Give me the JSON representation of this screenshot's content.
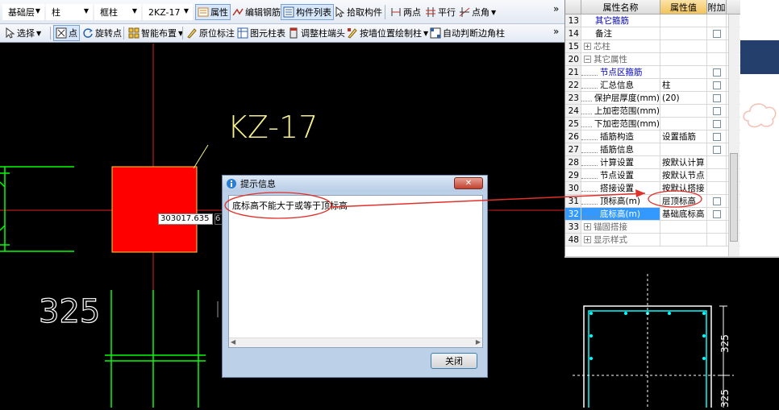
{
  "toolbar_top": {
    "floor_select": "基础层",
    "type_select": "柱",
    "subtype_select": "框柱",
    "member_select": "2KZ-17",
    "buttons": {
      "property": "属性",
      "edit_rebar": "编辑钢筋",
      "member_list": "构件列表",
      "pick_member": "拾取构件",
      "two_points": "两点",
      "parallel": "平行",
      "point_angle": "点角"
    },
    "more": "»"
  },
  "toolbar_bottom": {
    "buttons": {
      "select": "选择",
      "point": "点",
      "rotate_point": "旋转点",
      "smart_layout": "智能布置",
      "origin_annotate": "原位标注",
      "element_table": "图元柱表",
      "adjust_column_end": "调整柱端头",
      "draw_by_wall": "按墙位置绘制柱",
      "auto_corner": "自动判断边角柱"
    },
    "more": "»"
  },
  "canvas": {
    "column_label": "KZ-17",
    "dimension_label": "325",
    "coordinate_value": "303017.635",
    "coordinate_value2": "6"
  },
  "property_panel": {
    "headers": {
      "name": "属性名称",
      "value": "属性值",
      "add": "附加"
    },
    "rows": [
      {
        "num": "13",
        "name": "其它箍筋",
        "value": "",
        "has_check": false,
        "kind": "link",
        "expander": ""
      },
      {
        "num": "14",
        "name": "备注",
        "value": "",
        "has_check": true,
        "kind": "plain",
        "expander": ""
      },
      {
        "num": "15",
        "name": "芯柱",
        "value": "",
        "has_check": false,
        "kind": "group",
        "expander": "+"
      },
      {
        "num": "20",
        "name": "其它属性",
        "value": "",
        "has_check": false,
        "kind": "group",
        "expander": "−"
      },
      {
        "num": "21",
        "name": "节点区箍筋",
        "value": "",
        "has_check": true,
        "kind": "child-link",
        "expander": ""
      },
      {
        "num": "22",
        "name": "汇总信息",
        "value": "柱",
        "has_check": true,
        "kind": "child",
        "expander": ""
      },
      {
        "num": "23",
        "name": "保护层厚度(mm)",
        "value": "(20)",
        "has_check": true,
        "kind": "child",
        "expander": ""
      },
      {
        "num": "24",
        "name": "上加密范围(mm)",
        "value": "",
        "has_check": true,
        "kind": "child",
        "expander": ""
      },
      {
        "num": "25",
        "name": "下加密范围(mm)",
        "value": "",
        "has_check": true,
        "kind": "child",
        "expander": ""
      },
      {
        "num": "26",
        "name": "插筋构造",
        "value": "设置插筋",
        "has_check": true,
        "kind": "child",
        "expander": ""
      },
      {
        "num": "27",
        "name": "插筋信息",
        "value": "",
        "has_check": true,
        "kind": "child",
        "expander": ""
      },
      {
        "num": "28",
        "name": "计算设置",
        "value": "按默认计算",
        "has_check": false,
        "kind": "child",
        "expander": ""
      },
      {
        "num": "29",
        "name": "节点设置",
        "value": "按默认节点",
        "has_check": false,
        "kind": "child",
        "expander": ""
      },
      {
        "num": "30",
        "name": "搭接设置",
        "value": "按默认搭接",
        "has_check": false,
        "kind": "child",
        "expander": ""
      },
      {
        "num": "31",
        "name": "顶标高(m)",
        "value": "层顶标高",
        "has_check": true,
        "kind": "child",
        "expander": ""
      },
      {
        "num": "32",
        "name": "底标高(m)",
        "value": "基础底标高",
        "has_check": true,
        "kind": "child-selected",
        "expander": ""
      },
      {
        "num": "33",
        "name": "锚固搭接",
        "value": "",
        "has_check": false,
        "kind": "group",
        "expander": "+"
      },
      {
        "num": "48",
        "name": "显示样式",
        "value": "",
        "has_check": false,
        "kind": "group",
        "expander": "+"
      }
    ]
  },
  "preview": {
    "dim_top": "325",
    "dim_bottom": "325"
  },
  "dialog": {
    "title": "提示信息",
    "message": "底标高不能大于或等于顶标高",
    "close_button": "关闭",
    "close_x": "✕"
  },
  "colors": {
    "canvas_bg": "#000000",
    "column_fill": "#ff0000",
    "green_lines": "#00ff00",
    "label_yellow": "#f5f08c",
    "annotation_red": "#e0302a",
    "link_blue": "#0000cc",
    "selection_blue": "#3399ff"
  }
}
